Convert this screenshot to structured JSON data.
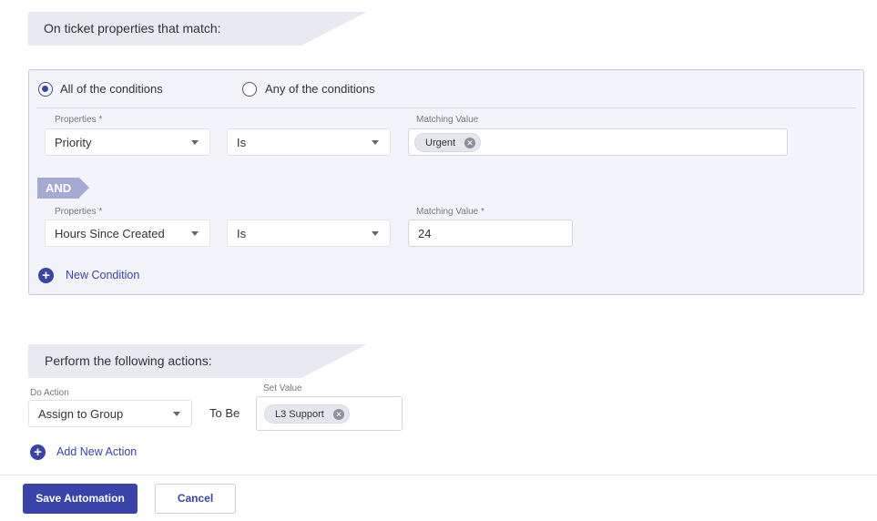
{
  "conditions_section": {
    "title": "On ticket properties that match:",
    "match_options": [
      {
        "label": "All of the conditions",
        "checked": true
      },
      {
        "label": "Any of the conditions",
        "checked": false
      }
    ],
    "rows": [
      {
        "property_label": "Properties *",
        "property_value": "Priority",
        "operator_value": "Is",
        "matching_label": "Matching Value",
        "matching_chips": [
          "Urgent"
        ]
      },
      {
        "property_label": "Properties *",
        "property_value": "Hours Since Created",
        "operator_value": "Is",
        "matching_label": "Matching Value *",
        "matching_text": "24"
      }
    ],
    "joiner": "AND",
    "new_condition_label": "New Condition"
  },
  "actions_section": {
    "title": "Perform the following actions:",
    "do_action_label": "Do Action",
    "do_action_value": "Assign to Group",
    "to_be_label": "To Be",
    "set_value_label": "Set Value",
    "set_value_chips": [
      "L3 Support"
    ],
    "add_action_label": "Add New Action"
  },
  "footer": {
    "save_label": "Save Automation",
    "cancel_label": "Cancel"
  },
  "colors": {
    "accent": "#3a44a8",
    "and_tag": "#a5aad5",
    "panel_bg": "#f3f4fa",
    "banner_bg": "#e8e9f1"
  },
  "icons": {
    "remove_chip": "close-circle-icon",
    "add": "plus-circle-icon",
    "dropdown": "chevron-down-icon"
  }
}
